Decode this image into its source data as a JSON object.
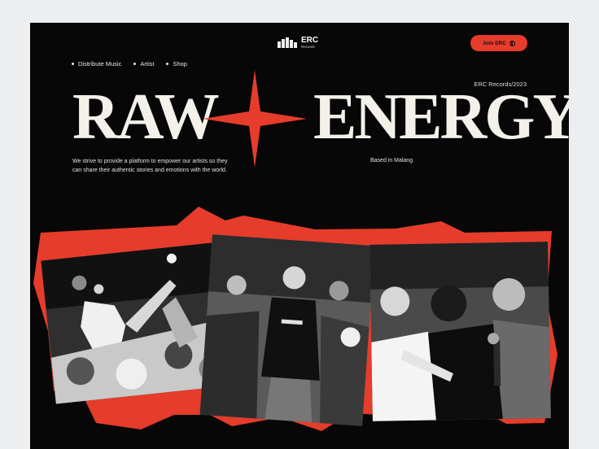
{
  "nav": {
    "items": [
      {
        "label": "Distribute Music"
      },
      {
        "label": "Artist"
      },
      {
        "label": "Shop"
      }
    ]
  },
  "brand": {
    "title": "ERC",
    "subtitle": "Records"
  },
  "join": {
    "label": "Join ERC",
    "icon": "globe-icon"
  },
  "meta": {
    "label": "ERC Records/2023"
  },
  "hero": {
    "headline_left": "RAW",
    "headline_right": "ENERGY",
    "star_icon": "four-point-star-icon",
    "mission": "We strive to provide a platform to empower our artists so they can share their authentic stories and emotions with the world.",
    "location": "Based in Malang"
  },
  "colors": {
    "background": "#070707",
    "accent": "#e63c2b",
    "text": "#f3f1ea",
    "page": "#eceef0"
  }
}
